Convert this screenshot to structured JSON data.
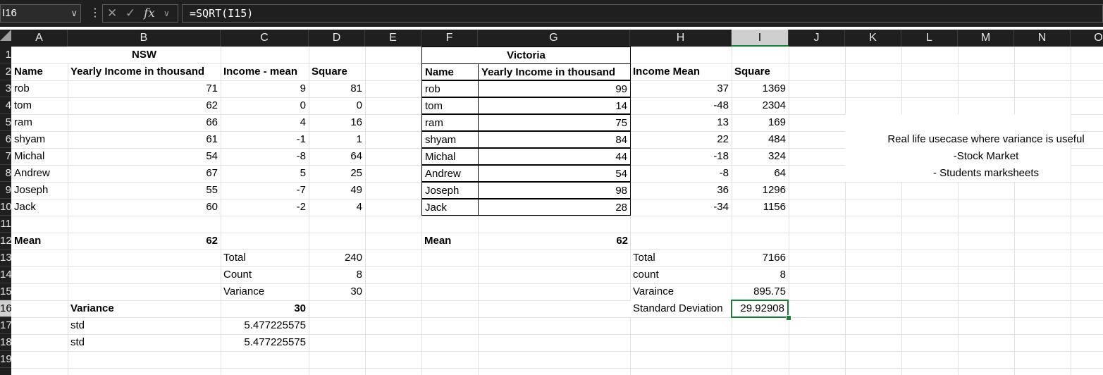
{
  "formula_bar": {
    "name_box": "I16",
    "formula": "=SQRT(I15)",
    "fx_label": "fx"
  },
  "columns": [
    "A",
    "B",
    "C",
    "D",
    "E",
    "F",
    "G",
    "H",
    "I",
    "J",
    "K",
    "L",
    "M",
    "N",
    "O"
  ],
  "selected_column": "I",
  "rows": [
    "1",
    "2",
    "3",
    "4",
    "5",
    "6",
    "7",
    "8",
    "9",
    "10",
    "11",
    "12",
    "13",
    "14",
    "15",
    "16",
    "17",
    "18",
    "19"
  ],
  "selected_row": "16",
  "nsw": {
    "title": "NSW",
    "headers": [
      "Name",
      "Yearly Income in thousand",
      "Income - mean",
      "Square"
    ],
    "data": [
      [
        "rob",
        "71",
        "9",
        "81"
      ],
      [
        "tom",
        "62",
        "0",
        "0"
      ],
      [
        "ram",
        "66",
        "4",
        "16"
      ],
      [
        "shyam",
        "61",
        "-1",
        "1"
      ],
      [
        "Michal",
        "54",
        "-8",
        "64"
      ],
      [
        "Andrew",
        "67",
        "5",
        "25"
      ],
      [
        "Joseph",
        "55",
        "-7",
        "49"
      ],
      [
        "Jack",
        "60",
        "-2",
        "4"
      ]
    ],
    "mean_label": "Mean",
    "mean_value": "62",
    "total_label": "Total",
    "total_value": "240",
    "count_label": "Count",
    "count_value": "8",
    "variance_label": "Variance",
    "variance_value": "30",
    "variance2_label": "Variance",
    "variance2_value": "30",
    "std_label": "std",
    "std_value": "5.477225575",
    "std2_label": "std",
    "std2_value": "5.477225575"
  },
  "victoria": {
    "title": "Victoria",
    "headers": [
      "Name",
      "Yearly Income in thousand",
      "Income Mean",
      "Square"
    ],
    "data": [
      [
        "rob",
        "99",
        "37",
        "1369"
      ],
      [
        "tom",
        "14",
        "-48",
        "2304"
      ],
      [
        "ram",
        "75",
        "13",
        "169"
      ],
      [
        "shyam",
        "84",
        "22",
        "484"
      ],
      [
        "Michal",
        "44",
        "-18",
        "324"
      ],
      [
        "Andrew",
        "54",
        "-8",
        "64"
      ],
      [
        "Joseph",
        "98",
        "36",
        "1296"
      ],
      [
        "Jack",
        "28",
        "-34",
        "1156"
      ]
    ],
    "mean_label": "Mean",
    "mean_value": "62",
    "total_label": "Total",
    "total_value": "7166",
    "count_label": "count",
    "count_value": "8",
    "variance_label": "Varaince",
    "variance_value": "895.75",
    "stddev_label": "Standard Deviation",
    "stddev_value": "29.92908"
  },
  "note": {
    "line1": "Real life usecase where variance is useful",
    "line2": "-Stock Market",
    "line3": "- Students marksheets"
  },
  "colors": {
    "selection": "#1d7d3a",
    "chrome": "#1f1f1f"
  }
}
